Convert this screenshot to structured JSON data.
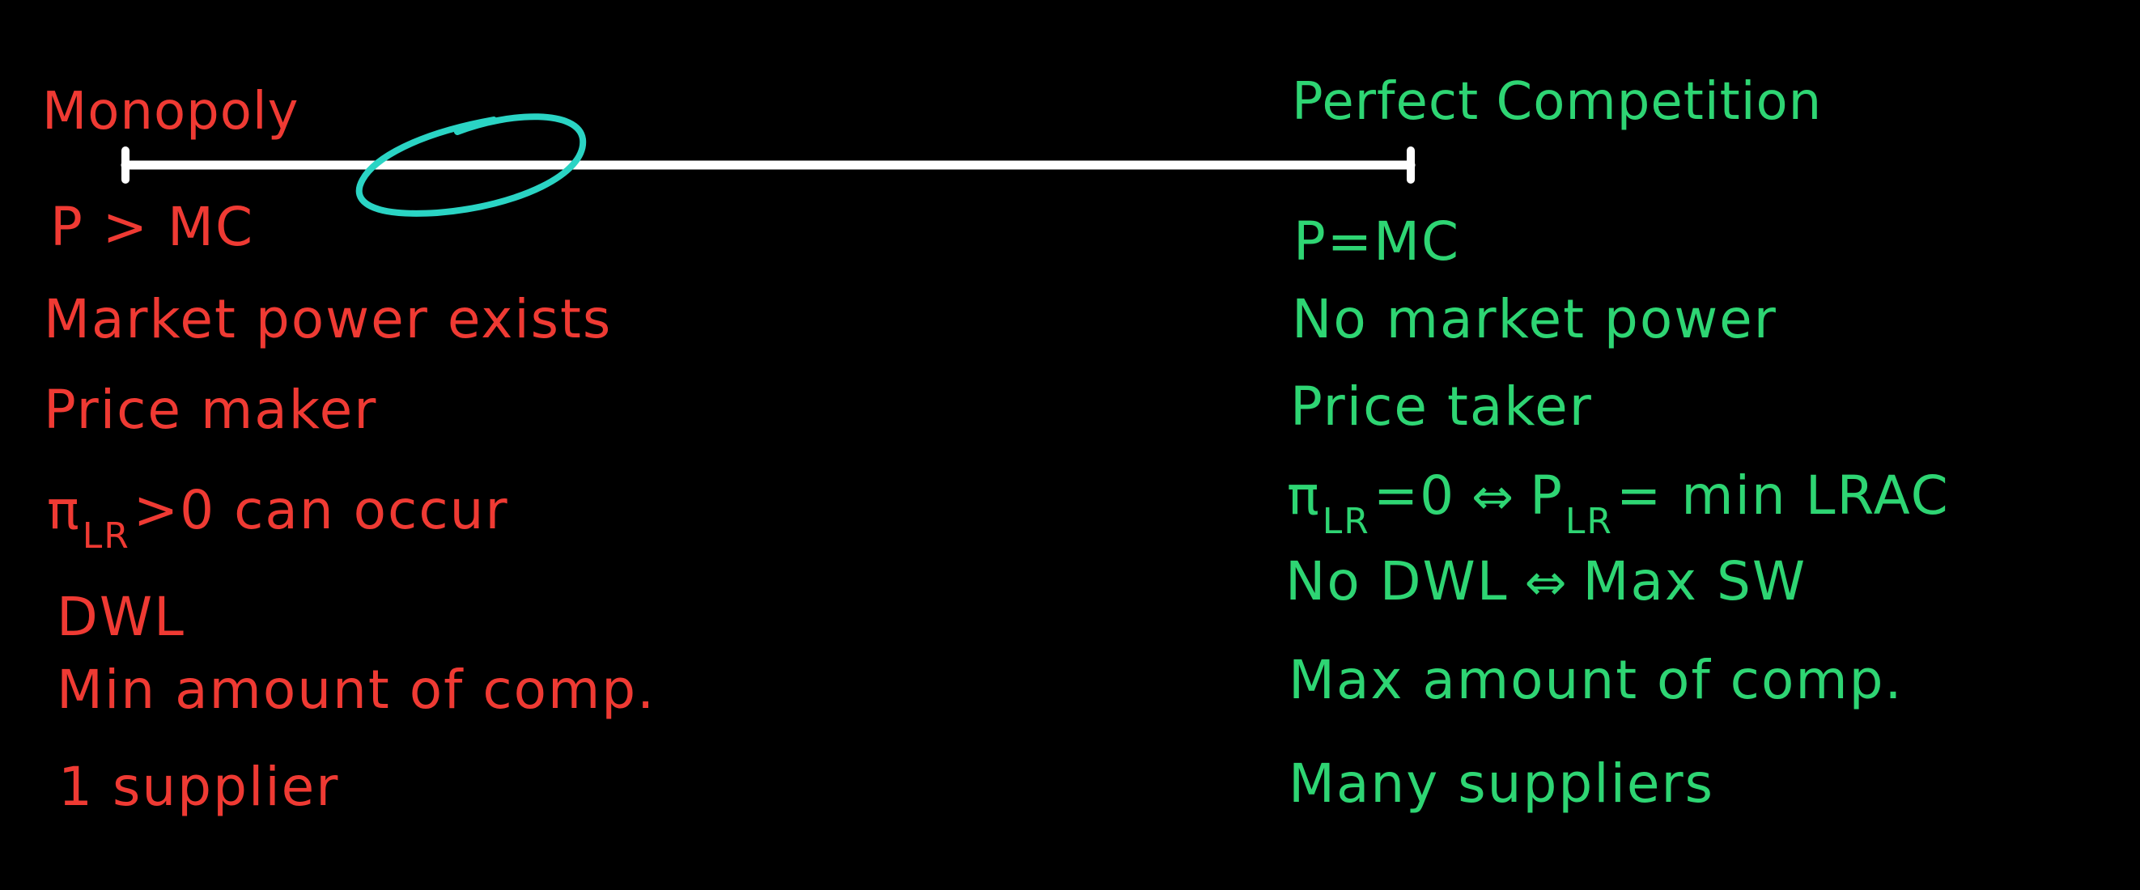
{
  "monopoly": {
    "title": "Monopoly",
    "items": [
      {
        "text": "P > MC"
      },
      {
        "text": "Market power exists"
      },
      {
        "text": "Price maker"
      },
      {
        "pre": "π",
        "sub": "LR",
        "post": ">0  can occur"
      },
      {
        "text": "DWL"
      },
      {
        "text": "Min amount of comp."
      },
      {
        "text": "1 supplier"
      }
    ]
  },
  "perfect_competition": {
    "title": "Perfect Competition",
    "items": [
      {
        "text": "P=MC"
      },
      {
        "text": "No market power"
      },
      {
        "text": "Price taker"
      },
      {
        "pre": "π",
        "sub": "LR",
        "mid": "=0",
        "arrow": "⇔",
        "pre2": "P",
        "sub2": "LR",
        "post": "= min LRAC"
      },
      {
        "pre": "No DWL",
        "arrow": "⇔",
        "post": "Max SW"
      },
      {
        "text": "Max amount of comp."
      },
      {
        "text": "Many suppliers"
      }
    ]
  },
  "colors": {
    "monopoly": "#ef3a33",
    "perfect_competition": "#2ed573",
    "scale_line": "#ffffff",
    "highlight_circle": "#2ad4c4"
  }
}
